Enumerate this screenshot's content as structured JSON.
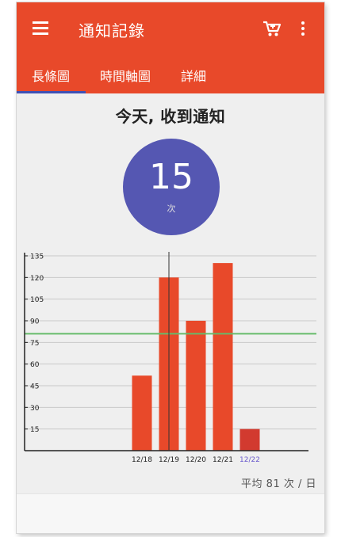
{
  "app": {
    "title": "通知記錄",
    "accent_color": "#e8492a",
    "indicator_color": "#3f51b5"
  },
  "icons": [
    "menu-icon",
    "cart-icon",
    "more-vert-icon"
  ],
  "tabs": [
    {
      "label": "長條圖",
      "selected": true
    },
    {
      "label": "時間軸圖",
      "selected": false
    },
    {
      "label": "詳細",
      "selected": false
    }
  ],
  "summary": {
    "heading": "今天, 收到通知",
    "count": "15",
    "unit": "次",
    "circle_color": "#5557b2"
  },
  "average_text": "平均 81 次 / 日",
  "chart_data": {
    "type": "bar",
    "categories": [
      "12/18",
      "12/19",
      "12/20",
      "12/21",
      "12/22"
    ],
    "values": [
      52,
      120,
      90,
      130,
      15
    ],
    "highlighted_category": "12/22",
    "ylim": [
      0,
      135
    ],
    "yticks": [
      15,
      30,
      45,
      60,
      75,
      90,
      105,
      120,
      135
    ],
    "average_line": 81,
    "bar_color": "#e8492a",
    "highlight_bar_color": "#d23a2f",
    "average_line_color": "#66bb6a",
    "cursor_category": "12/19",
    "grid": true,
    "title": "",
    "xlabel": "",
    "ylabel": ""
  }
}
